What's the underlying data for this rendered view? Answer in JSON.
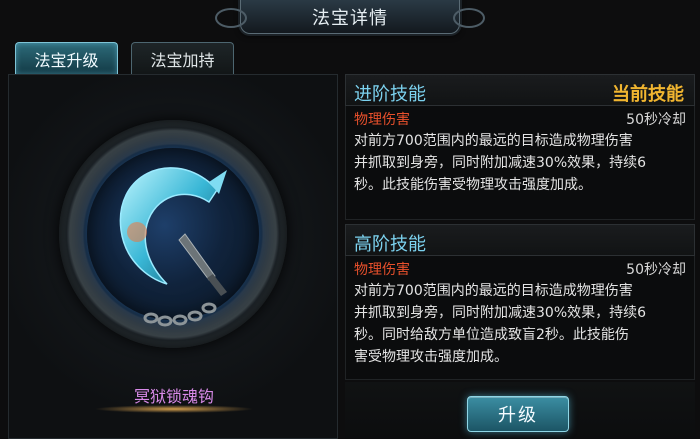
{
  "header": {
    "title": "法宝详情"
  },
  "tabs": [
    {
      "label": "法宝升级",
      "active": true
    },
    {
      "label": "法宝加持",
      "active": false
    }
  ],
  "item": {
    "name": "冥狱锁魂钩",
    "icon": "chain-hook-icon"
  },
  "skills": [
    {
      "title": "进阶技能",
      "badge": "当前技能",
      "type": "物理伤害",
      "cooldown": "50秒冷却",
      "lines": [
        "对前方700范围内的最远的目标造成物理伤害",
        "并抓取到身旁，同时附加减速30%效果，持续6",
        "秒。此技能伤害受物理攻击强度加成。"
      ]
    },
    {
      "title": "高阶技能",
      "type": "物理伤害",
      "cooldown": "50秒冷却",
      "lines": [
        "对前方700范围内的最远的目标造成物理伤害",
        "并抓取到身旁，同时附加减速30%效果，持续6",
        "秒。同时给敌方单位造成致盲2秒。此技能伤",
        "害受物理攻击强度加成。"
      ]
    }
  ],
  "actions": {
    "upgrade_label": "升级"
  },
  "colors": {
    "skill_title": "#7cd2ef",
    "current_badge": "#f0b530",
    "damage_type": "#e8502c",
    "item_name": "#d88ae8"
  }
}
